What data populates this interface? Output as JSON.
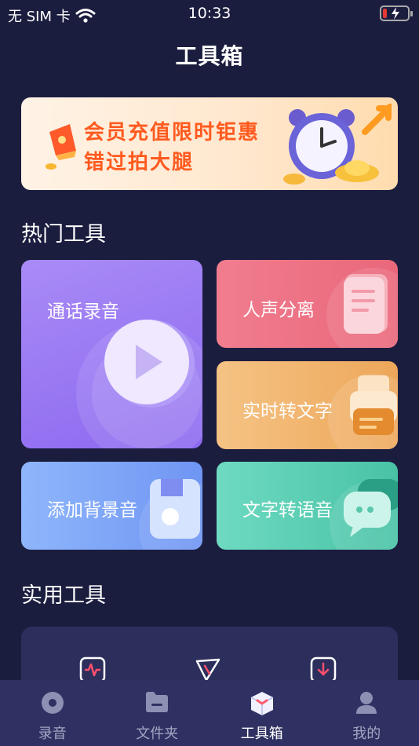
{
  "status": {
    "carrier": "无 SIM 卡",
    "time": "10:33"
  },
  "header": {
    "title": "工具箱"
  },
  "banner": {
    "line1": "会员充值限时钜惠",
    "line2": "错过拍大腿"
  },
  "hot_tools": {
    "title": "热门工具",
    "items": [
      {
        "label": "通话录音",
        "icon": "play-icon"
      },
      {
        "label": "人声分离",
        "icon": "document-icon"
      },
      {
        "label": "实时转文字",
        "icon": "printer-icon"
      },
      {
        "label": "添加背景音",
        "icon": "sd-card-icon"
      },
      {
        "label": "文字转语音",
        "icon": "chat-bubble-icon"
      }
    ]
  },
  "utility_tools": {
    "title": "实用工具",
    "icons": [
      "waveform-icon",
      "scissors-icon",
      "download-icon"
    ]
  },
  "tabbar": {
    "items": [
      {
        "label": "录音",
        "icon": "record-icon"
      },
      {
        "label": "文件夹",
        "icon": "folder-icon"
      },
      {
        "label": "工具箱",
        "icon": "toolbox-icon",
        "active": true
      },
      {
        "label": "我的",
        "icon": "person-icon"
      }
    ]
  },
  "colors": {
    "background": "#1b1d3f",
    "banner_text": "#ff5a1f",
    "tabbar": "#2e3161"
  }
}
